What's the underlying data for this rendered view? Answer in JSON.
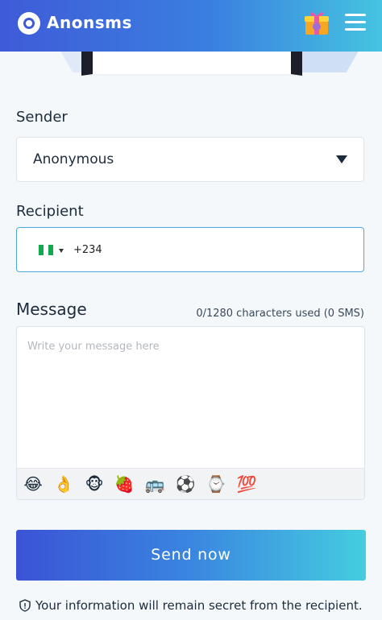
{
  "app": {
    "brand": "Anonsms",
    "icons": {
      "logo": "logo-icon",
      "gift": "gift-icon",
      "menu": "hamburger-menu-icon"
    }
  },
  "form": {
    "sender_label": "Sender",
    "sender_value": "Anonymous",
    "recipient_label": "Recipient",
    "recipient_country": "NG",
    "recipient_dial_code": "+234",
    "message_label": "Message",
    "counter_text": "0/1280 characters used (0 SMS)",
    "message_placeholder": "Write your message here",
    "emojis": [
      "😂",
      "👌",
      "🐵",
      "🍓",
      "🚌",
      "⚽",
      "⌚",
      "💯"
    ]
  },
  "send_button": {
    "label": "Send now"
  },
  "footer": {
    "note": "Your information will remain secret from the recipient."
  },
  "colors": {
    "accent_start": "#3b53d6",
    "accent_end": "#45cde0",
    "focus_border": "#4aa9d8",
    "flag_green": "#11a850"
  }
}
